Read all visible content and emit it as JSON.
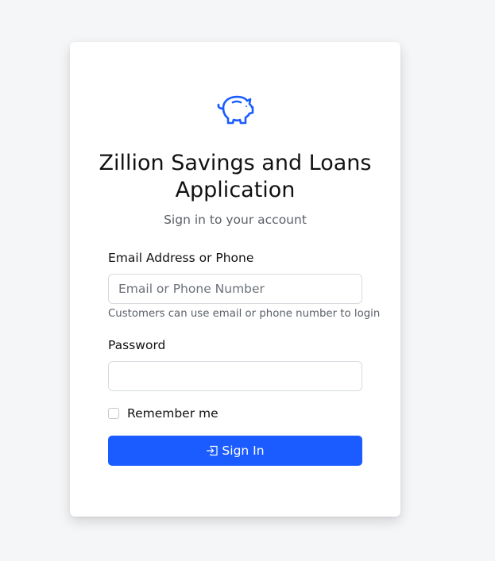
{
  "app": {
    "title": "Zillion Savings and Loans Application",
    "subtitle": "Sign in to your account",
    "logo_icon": "piggy-bank-icon",
    "accent_color": "#1a5cff"
  },
  "form": {
    "email": {
      "label": "Email Address or Phone",
      "placeholder": "Email or Phone Number",
      "value": "",
      "help": "Customers can use email or phone number to login"
    },
    "password": {
      "label": "Password",
      "value": ""
    },
    "remember": {
      "label": "Remember me",
      "checked": false
    },
    "submit": {
      "label": "Sign In",
      "icon": "sign-in-icon"
    }
  }
}
